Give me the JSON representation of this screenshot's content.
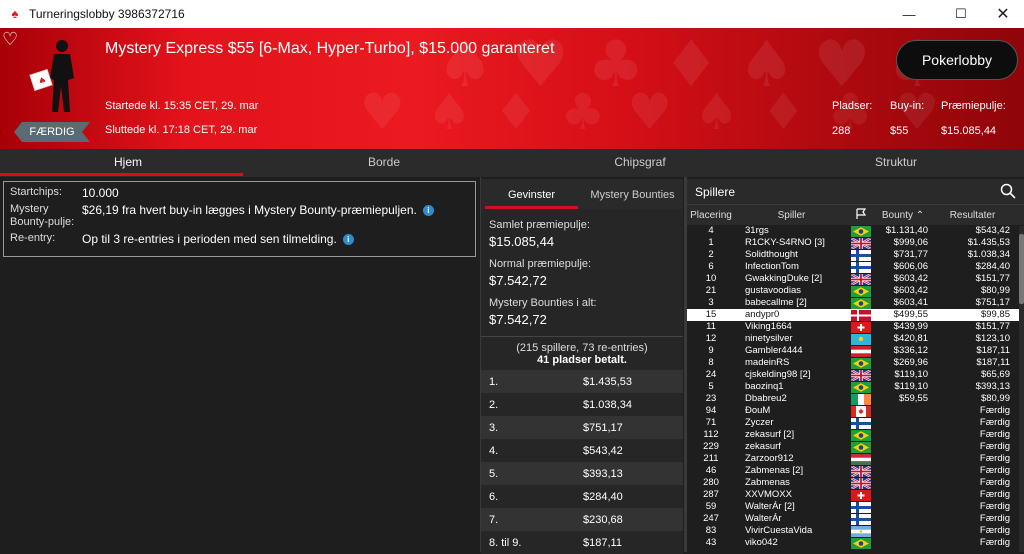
{
  "window": {
    "title": "Turneringslobby 3986372716"
  },
  "banner": {
    "event_title": "Mystery Express $55 [6-Max, Hyper-Turbo], $15.000 garanteret",
    "started": "Startede kl. 15:35 CET, 29. mar",
    "ended": "Sluttede kl. 17:18 CET, 29. mar",
    "status_badge": "FÆRDIG",
    "lobby_button": "Pokerlobby",
    "stats": {
      "seats_label": "Pladser:",
      "seats_value": "288",
      "buyin_label": "Buy-in:",
      "buyin_value": "$55",
      "pool_label": "Præmiepulje:",
      "pool_value": "$15.085,44"
    }
  },
  "tabs": [
    "Hjem",
    "Borde",
    "Chipsgraf",
    "Struktur"
  ],
  "info": {
    "startchips_label": "Startchips:",
    "startchips_value": "10.000",
    "bounty_label": "Mystery Bounty-pulje:",
    "bounty_value": "$26,19 fra hvert buy-in lægges i Mystery Bounty-præmiepuljen.",
    "reentry_label": "Re-entry:",
    "reentry_value": "Op til 3 re-entries i perioden med sen tilmelding."
  },
  "prizes": {
    "subtabs": [
      "Gevinster",
      "Mystery Bounties"
    ],
    "total_label": "Samlet præmiepulje:",
    "total_value": "$15.085,44",
    "normal_label": "Normal præmiepulje:",
    "normal_value": "$7.542,72",
    "bounties_label": "Mystery Bounties i alt:",
    "bounties_value": "$7.542,72",
    "summary_line1": "(215 spillere, 73 re-entries)",
    "summary_line2": "41 pladser betalt.",
    "payouts": [
      {
        "place": "1.",
        "amount": "$1.435,53"
      },
      {
        "place": "2.",
        "amount": "$1.038,34"
      },
      {
        "place": "3.",
        "amount": "$751,17"
      },
      {
        "place": "4.",
        "amount": "$543,42"
      },
      {
        "place": "5.",
        "amount": "$393,13"
      },
      {
        "place": "6.",
        "amount": "$284,40"
      },
      {
        "place": "7.",
        "amount": "$230,68"
      },
      {
        "place": "8. til 9.",
        "amount": "$187,11"
      }
    ]
  },
  "players": {
    "header": "Spillere",
    "columns": {
      "place": "Placering",
      "player": "Spiller",
      "bounty": "Bounty",
      "result": "Resultater"
    },
    "rows": [
      {
        "place": "4",
        "name": "31rgs",
        "flag": "br",
        "bounty": "$1.131,40",
        "result": "$543,42"
      },
      {
        "place": "1",
        "name": "R1CKY-S4RNO [3]",
        "flag": "gb",
        "bounty": "$999,06",
        "result": "$1.435,53"
      },
      {
        "place": "2",
        "name": "Solidthought",
        "flag": "fi",
        "bounty": "$731,77",
        "result": "$1.038,34"
      },
      {
        "place": "6",
        "name": "InfectionTom",
        "flag": "fi",
        "bounty": "$606,06",
        "result": "$284,40"
      },
      {
        "place": "10",
        "name": "GwakkingDuke [2]",
        "flag": "gb",
        "bounty": "$603,42",
        "result": "$151,77"
      },
      {
        "place": "21",
        "name": "gustavoodias",
        "flag": "br",
        "bounty": "$603,42",
        "result": "$80,99"
      },
      {
        "place": "3",
        "name": "babecallme [2]",
        "flag": "br",
        "bounty": "$603,41",
        "result": "$751,17"
      },
      {
        "place": "15",
        "name": "andypr0",
        "flag": "dk",
        "bounty": "$499,55",
        "result": "$99,85",
        "highlight": true
      },
      {
        "place": "11",
        "name": "Viking1664",
        "flag": "ch",
        "bounty": "$439,99",
        "result": "$151,77"
      },
      {
        "place": "12",
        "name": "ninetysilver",
        "flag": "kz",
        "bounty": "$420,81",
        "result": "$123,10"
      },
      {
        "place": "9",
        "name": "Gambler4444",
        "flag": "at",
        "bounty": "$336,12",
        "result": "$187,11"
      },
      {
        "place": "8",
        "name": "madeinRS",
        "flag": "br",
        "bounty": "$269,96",
        "result": "$187,11"
      },
      {
        "place": "24",
        "name": "cjskelding98 [2]",
        "flag": "gb",
        "bounty": "$119,10",
        "result": "$65,69"
      },
      {
        "place": "5",
        "name": "baozinq1",
        "flag": "br",
        "bounty": "$119,10",
        "result": "$393,13"
      },
      {
        "place": "23",
        "name": "Dbabreu2",
        "flag": "ie",
        "bounty": "$59,55",
        "result": "$80,99"
      },
      {
        "place": "94",
        "name": "ĐouM",
        "flag": "ca",
        "bounty": "",
        "result": "Færdig"
      },
      {
        "place": "71",
        "name": "Zyczer",
        "flag": "fi",
        "bounty": "",
        "result": "Færdig"
      },
      {
        "place": "112",
        "name": "zekasurf [2]",
        "flag": "br",
        "bounty": "",
        "result": "Færdig"
      },
      {
        "place": "229",
        "name": "zekasurf",
        "flag": "br",
        "bounty": "",
        "result": "Færdig"
      },
      {
        "place": "211",
        "name": "Zarzoor912",
        "flag": "hu",
        "bounty": "",
        "result": "Færdig"
      },
      {
        "place": "46",
        "name": "Zabmenas [2]",
        "flag": "gb",
        "bounty": "",
        "result": "Færdig"
      },
      {
        "place": "280",
        "name": "Zabmenas",
        "flag": "gb",
        "bounty": "",
        "result": "Færdig"
      },
      {
        "place": "287",
        "name": "XXVMOXX",
        "flag": "ch",
        "bounty": "",
        "result": "Færdig"
      },
      {
        "place": "59",
        "name": "WalterÁr [2]",
        "flag": "fi",
        "bounty": "",
        "result": "Færdig"
      },
      {
        "place": "247",
        "name": "WalterÁr",
        "flag": "fi",
        "bounty": "",
        "result": "Færdig"
      },
      {
        "place": "83",
        "name": "VivirCuestaVida",
        "flag": "ar",
        "bounty": "",
        "result": "Færdig"
      },
      {
        "place": "43",
        "name": "viko042",
        "flag": "br",
        "bounty": "",
        "result": "Færdig"
      }
    ]
  },
  "colors": {
    "accent": "#d3111b",
    "banner_red": "#e3121b",
    "dark_bg": "#1e1e1e"
  }
}
